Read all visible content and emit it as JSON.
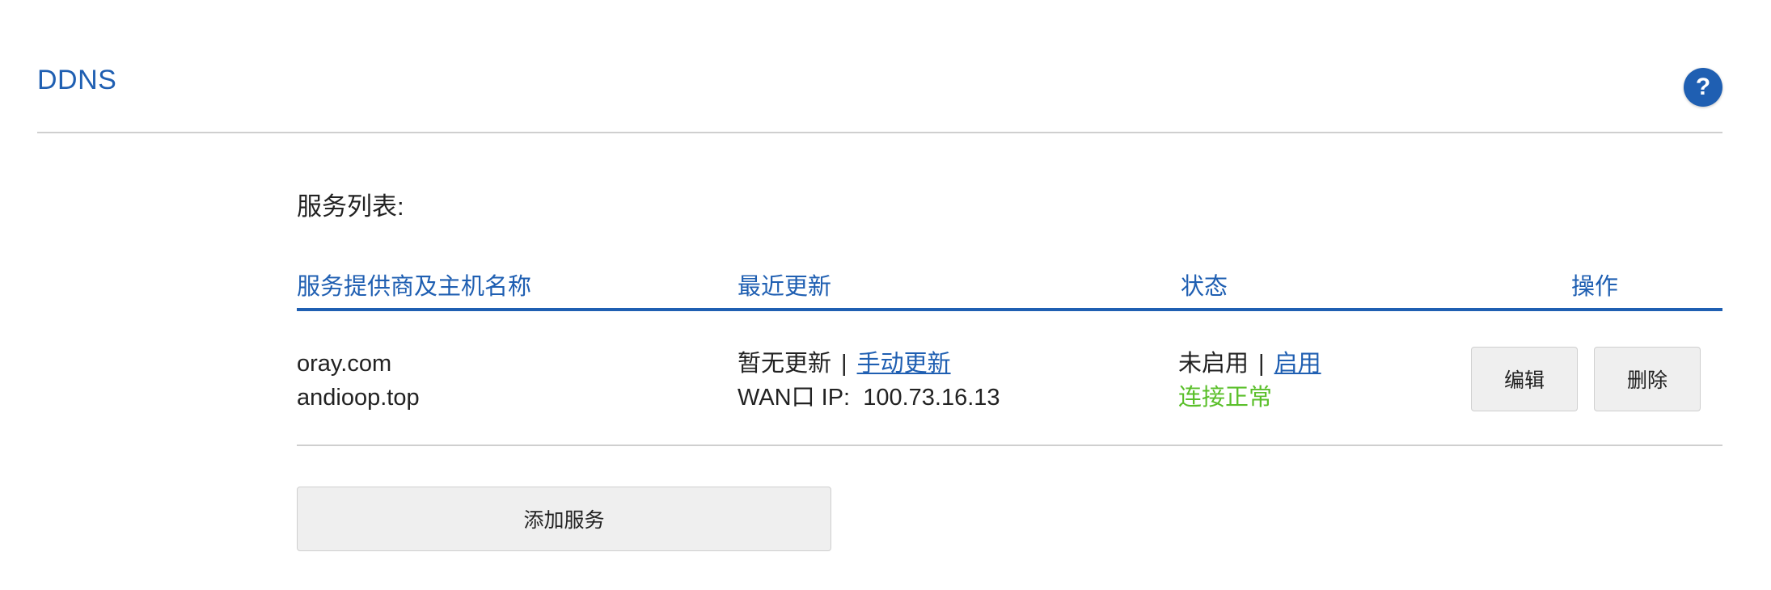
{
  "header": {
    "title": "DDNS",
    "help_icon": "question-icon",
    "help_label": "?"
  },
  "section": {
    "label": "服务列表:"
  },
  "table": {
    "columns": [
      "服务提供商及主机名称",
      "最近更新",
      "状态",
      "操作"
    ],
    "rows": [
      {
        "provider": "oray.com",
        "hostname": "andioop.top",
        "update_status": "暂无更新",
        "update_separator": "|",
        "manual_update": "手动更新",
        "wan_ip": "WAN口 IP:  100.73.16.13",
        "status": "未启用",
        "status_separator": "|",
        "enable_link": "启用",
        "connection": "连接正常",
        "edit_label": "编辑",
        "delete_label": "删除"
      }
    ]
  },
  "add_service_label": "添加服务",
  "colors": {
    "accent": "#1f5fb2",
    "success": "#5abf2a",
    "button_bg": "#efefef",
    "divider": "#cfcfcf"
  }
}
